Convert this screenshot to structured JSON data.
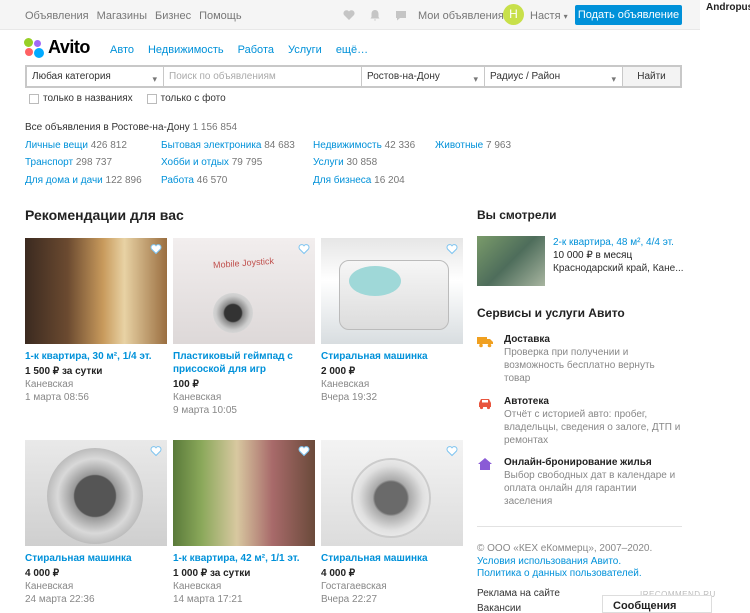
{
  "topbar": {
    "nav": [
      "Объявления",
      "Магазины",
      "Бизнес",
      "Помощь"
    ],
    "my_ads": "Мои объявления",
    "avatar_letter": "Н",
    "user_name": "Настя",
    "post_button": "Подать объявление",
    "side_user": "Andropus"
  },
  "logo": {
    "name": "Avito"
  },
  "categories_nav": [
    "Авто",
    "Недвижимость",
    "Работа",
    "Услуги",
    "ещё…"
  ],
  "search": {
    "category": "Любая категория",
    "placeholder": "Поиск по объявлениям",
    "city": "Ростов-на-Дону",
    "radius": "Радиус / Район",
    "button": "Найти",
    "only_titles": "только в названиях",
    "only_photo": "только с фото"
  },
  "all_ads": {
    "label": "Все объявления в Ростове-на-Дону",
    "count": "1 156 854"
  },
  "category_counts": [
    {
      "label": "Личные вещи",
      "count": "426 812"
    },
    {
      "label": "Бытовая электроника",
      "count": "84 683"
    },
    {
      "label": "Недвижимость",
      "count": "42 336"
    },
    {
      "label": "Животные",
      "count": "7 963"
    },
    {
      "label": "Транспорт",
      "count": "298 737"
    },
    {
      "label": "Хобби и отдых",
      "count": "79 795"
    },
    {
      "label": "Услуги",
      "count": "30 858"
    },
    {
      "label": "Для дома и дачи",
      "count": "122 896"
    },
    {
      "label": "Работа",
      "count": "46 570"
    },
    {
      "label": "Для бизнеса",
      "count": "16 204"
    }
  ],
  "recommendations": {
    "title": "Рекомендации для вас",
    "items": [
      {
        "title": "1-к квартира, 30 м², 1/4 эт.",
        "price": "1 500 ₽ за сутки",
        "location": "Каневская",
        "date": "1 марта 08:56"
      },
      {
        "title": "Пластиковый геймпад с присоской для игр",
        "price": "100 ₽",
        "location": "Каневская",
        "date": "9 марта 10:05",
        "image_caption": "Mobile Joystick"
      },
      {
        "title": "Стиральная машинка",
        "price": "2 000 ₽",
        "location": "Каневская",
        "date": "Вчера 19:32"
      },
      {
        "title": "Стиральная машинка",
        "price": "4 000 ₽",
        "location": "Каневская",
        "date": "24 марта 22:36"
      },
      {
        "title": "1-к квартира, 42 м², 1/1 эт.",
        "price": "1 000 ₽ за сутки",
        "location": "Каневская",
        "date": "14 марта 17:21"
      },
      {
        "title": "Стиральная машинка",
        "price": "4 000 ₽",
        "location": "Гостагаевская",
        "date": "Вчера 22:27"
      }
    ]
  },
  "viewed": {
    "title": "Вы смотрели",
    "item_title": "2-к квартира, 48 м², 4/4 эт.",
    "item_price": "10 000 ₽ в месяц",
    "item_location": "Краснодарский край, Кане..."
  },
  "services": {
    "title": "Сервисы и услуги Авито",
    "items": [
      {
        "title": "Доставка",
        "text": "Проверка при получении и возможность бесплатно вернуть товар",
        "icon": "truck-icon",
        "color": "#f0a020"
      },
      {
        "title": "Автотека",
        "text": "Отчёт с историей авто: пробег, владельцы, сведения о залоге, ДТП и ремонтах",
        "icon": "car-icon",
        "color": "#e8553e"
      },
      {
        "title": "Онлайн-бронирование жилья",
        "text": "Выбор свободных дат в календаре и оплата онлайн для гарантии заселения",
        "icon": "house-icon",
        "color": "#8a5bd6"
      }
    ]
  },
  "footer": {
    "copyright": "© ООО «КЕХ еКоммерц», 2007–2020.",
    "terms": "Условия использования Авито.",
    "privacy": "Политика о данных пользователей.",
    "ads_link": "Реклама на сайте",
    "jobs_link": "Вакансии"
  },
  "messages": "Сообщения",
  "watermark": "IRECOMMEND.RU",
  "colors": {
    "accent": "#0091d9",
    "avatar": "#c8e04a"
  }
}
